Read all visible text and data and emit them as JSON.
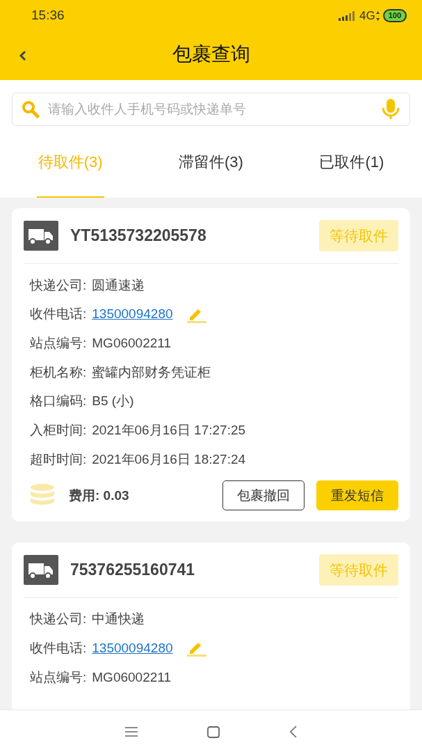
{
  "status_bar": {
    "time": "15:36",
    "network": "4G",
    "battery": "100"
  },
  "header": {
    "title": "包裹查询"
  },
  "search": {
    "placeholder": "请输入收件人手机号码或快递单号"
  },
  "tabs": [
    {
      "label": "待取件(3)",
      "selected": true
    },
    {
      "label": "滞留件(3)",
      "selected": false
    },
    {
      "label": "已取件(1)",
      "selected": false
    }
  ],
  "parcels": [
    {
      "tracking": "YT5135732205578",
      "status": "等待取件",
      "fields": [
        {
          "kind": "text",
          "label": "快递公司:",
          "value": "圆通速递"
        },
        {
          "kind": "phone",
          "label": "收件电话:",
          "value": "13500094280"
        },
        {
          "kind": "text",
          "label": "站点编号:",
          "value": "MG06002211"
        },
        {
          "kind": "text",
          "label": "柜机名称:",
          "value": "蜜罐内部财务凭证柜"
        },
        {
          "kind": "text",
          "label": "格口编码:",
          "value": "B5 (小)"
        },
        {
          "kind": "text",
          "label": "入柜时间:",
          "value": "2021年06月16日 17:27:25"
        },
        {
          "kind": "text",
          "label": "超时时间:",
          "value": "2021年06月16日 18:27:24"
        }
      ],
      "fee": "费用: 0.03",
      "buttons": [
        {
          "label": "包裹撤回",
          "kind": "outline"
        },
        {
          "label": "重发短信",
          "kind": "primary"
        }
      ]
    },
    {
      "tracking": "75376255160741",
      "status": "等待取件",
      "fields": [
        {
          "kind": "text",
          "label": "快递公司:",
          "value": "中通快递"
        },
        {
          "kind": "phone",
          "label": "收件电话:",
          "value": "13500094280"
        },
        {
          "kind": "text",
          "label": "站点编号:",
          "value": "MG06002211"
        }
      ]
    }
  ]
}
